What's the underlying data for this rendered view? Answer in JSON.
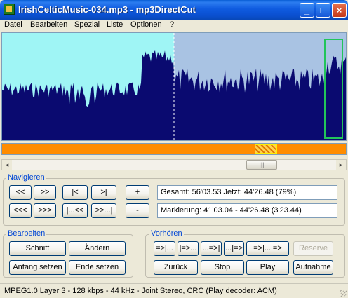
{
  "window": {
    "title": "IrishCelticMusic-034.mp3 - mp3DirectCut",
    "buttons": {
      "minimize": "_",
      "maximize": "□",
      "close": "×"
    }
  },
  "menu": [
    "Datei",
    "Bearbeiten",
    "Spezial",
    "Liste",
    "Optionen",
    "?"
  ],
  "waveform": {
    "colors": {
      "selection_bg": "#9ff5f5",
      "right_bg": "#a9c3e3",
      "wave": "#0a0a70",
      "marker": "#22c45a"
    }
  },
  "scrollbar": {
    "left_arrow": "◂",
    "right_arrow": "▸",
    "thumb_grip": "|||"
  },
  "navigieren": {
    "title": "Navigieren",
    "row1": [
      "<<",
      ">>",
      "|<",
      ">|",
      "+"
    ],
    "row2": [
      "<<<",
      ">>>",
      "|...<<",
      ">>...|",
      "-"
    ],
    "gesamt": "Gesamt: 56'03.53  Jetzt: 44'26.48  (79%)",
    "markierung": "Markierung: 41'03.04 - 44'26.48 (3'23.44)"
  },
  "bearbeiten": {
    "title": "Bearbeiten",
    "schnitt": "Schnitt",
    "aendern": "Ändern",
    "anfang_setzen": "Anfang setzen",
    "ende_setzen": "Ende setzen"
  },
  "vorhoeren": {
    "title": "Vorhören",
    "row1": [
      "=>|...",
      "|=>...",
      "...=>|",
      "...|=>",
      "=>|...|=>"
    ],
    "reserve": "Reserve",
    "zurueck": "Zurück",
    "stop": "Stop",
    "play": "Play",
    "aufnahme": "Aufnahme"
  },
  "statusbar": {
    "text": "MPEG1.0 Layer 3 - 128 kbps - 44 kHz - Joint Stereo, CRC   (Play decoder: ACM)"
  }
}
